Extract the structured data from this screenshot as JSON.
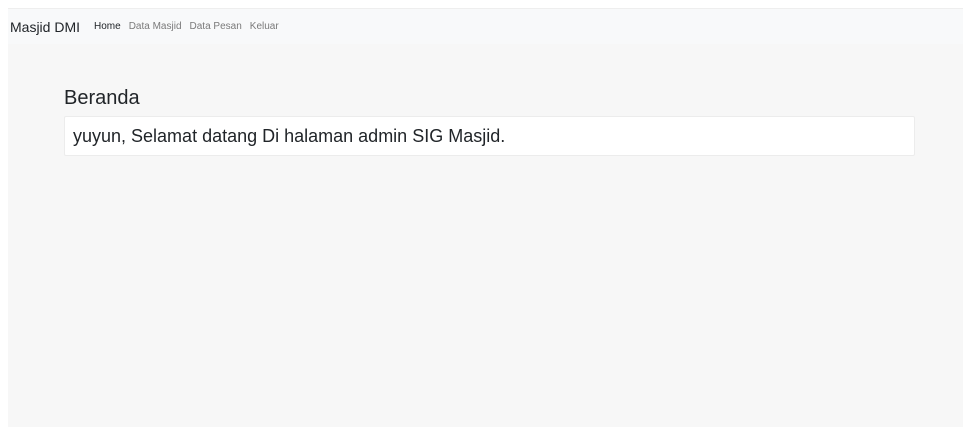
{
  "navbar": {
    "brand": "Masjid DMI",
    "links": [
      {
        "label": "Home",
        "active": true
      },
      {
        "label": "Data Masjid",
        "active": false
      },
      {
        "label": "Data Pesan",
        "active": false
      },
      {
        "label": "Keluar",
        "active": false
      }
    ]
  },
  "main": {
    "title": "Beranda",
    "welcome_text": "yuyun, Selamat datang Di halaman admin SIG Masjid."
  },
  "colors": {
    "navbar_bg": "#f8f9fa",
    "page_bg": "#f7f7f7",
    "card_bg": "#ffffff",
    "text": "#212529",
    "muted_link": "#7a7a7a"
  }
}
